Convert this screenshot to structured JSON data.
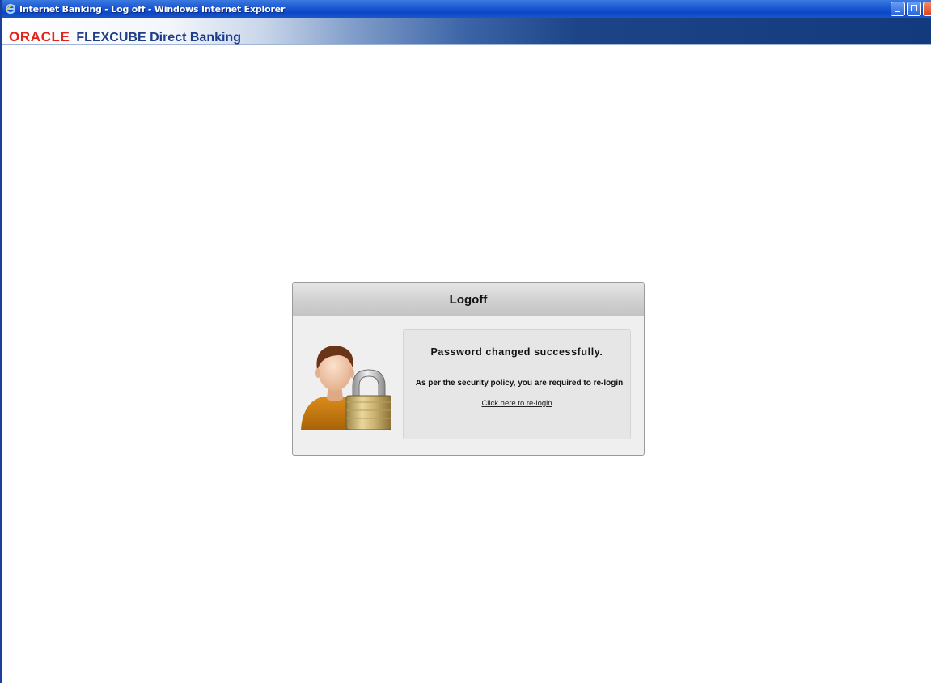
{
  "window": {
    "title": "Internet Banking - Log off - Windows Internet Explorer",
    "icon": "internet-explorer-icon"
  },
  "brand": {
    "oracle": "ORACLE",
    "product": "FLEXCUBE Direct Banking",
    "oracle_color": "#e2231a",
    "product_color": "#1f3c88"
  },
  "dialog": {
    "title": "Logoff",
    "icon": "user-lock-icon",
    "message_title": "Password changed successfully.",
    "policy_text": "As per the security policy, you are required to re-login",
    "relogin_link": "Click here to re-login"
  }
}
